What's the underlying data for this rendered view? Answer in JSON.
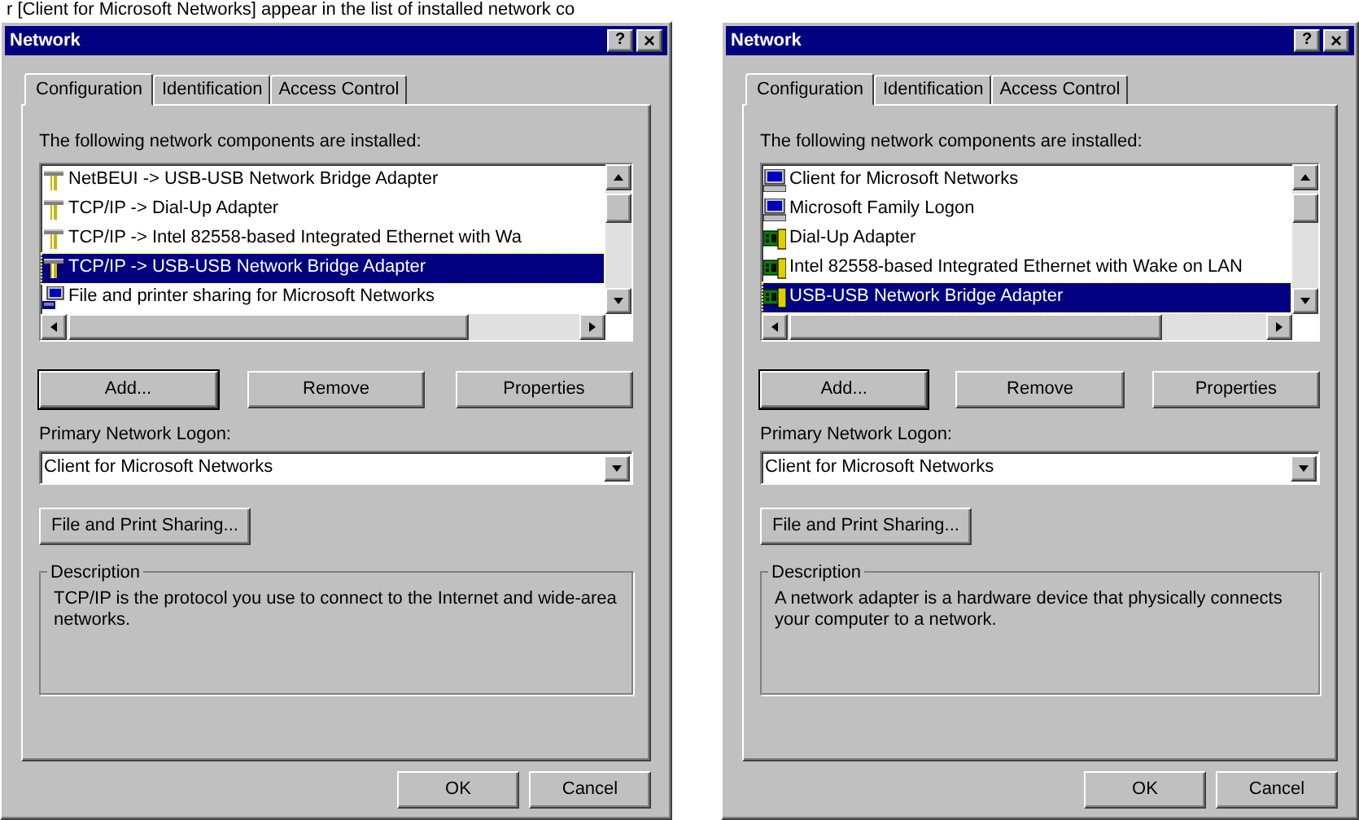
{
  "caption": "r [Client for Microsoft Networks] appear in the list of installed network co",
  "dialogs": [
    {
      "title": "Network",
      "help": "?",
      "close": "×",
      "tabs": [
        {
          "label": "Configuration",
          "selected": true
        },
        {
          "label": "Identification",
          "selected": false
        },
        {
          "label": "Access Control",
          "selected": false
        }
      ],
      "list_label": "The following network components are installed:",
      "components": [
        {
          "kind": "protocol",
          "label": "NetBEUI -> USB-USB Network Bridge Adapter",
          "selected": false
        },
        {
          "kind": "protocol",
          "label": "TCP/IP -> Dial-Up Adapter",
          "selected": false
        },
        {
          "kind": "protocol",
          "label": "TCP/IP -> Intel 82558-based Integrated Ethernet with Wa",
          "selected": false
        },
        {
          "kind": "protocol",
          "label": "TCP/IP -> USB-USB Network Bridge Adapter",
          "selected": true
        },
        {
          "kind": "service",
          "label": "File and printer sharing for Microsoft Networks",
          "selected": false
        }
      ],
      "buttons": [
        "Add...",
        "Remove",
        "Properties"
      ],
      "logon_label": "Primary Network Logon:",
      "logon_value": "Client for Microsoft Networks",
      "sharing_button": "File and Print Sharing...",
      "description_title": "Description",
      "description": "TCP/IP is the protocol you use to connect to the Internet and wide-area networks.",
      "footer_buttons": [
        "OK",
        "Cancel"
      ]
    },
    {
      "title": "Network",
      "help": "?",
      "close": "×",
      "tabs": [
        {
          "label": "Configuration",
          "selected": true
        },
        {
          "label": "Identification",
          "selected": false
        },
        {
          "label": "Access Control",
          "selected": false
        }
      ],
      "list_label": "The following network components are installed:",
      "components": [
        {
          "kind": "client",
          "label": "Client for Microsoft Networks",
          "selected": false
        },
        {
          "kind": "client",
          "label": "Microsoft Family Logon",
          "selected": false
        },
        {
          "kind": "adapter",
          "label": "Dial-Up Adapter",
          "selected": false
        },
        {
          "kind": "adapter",
          "label": "Intel 82558-based Integrated Ethernet with Wake on LAN",
          "selected": false
        },
        {
          "kind": "adapter",
          "label": "USB-USB Network Bridge Adapter",
          "selected": true
        }
      ],
      "buttons": [
        "Add...",
        "Remove",
        "Properties"
      ],
      "logon_label": "Primary Network Logon:",
      "logon_value": "Client for Microsoft Networks",
      "sharing_button": "File and Print Sharing...",
      "description_title": "Description",
      "description": "A network adapter is a hardware device that physically connects your computer to a network.",
      "footer_buttons": [
        "OK",
        "Cancel"
      ]
    }
  ]
}
